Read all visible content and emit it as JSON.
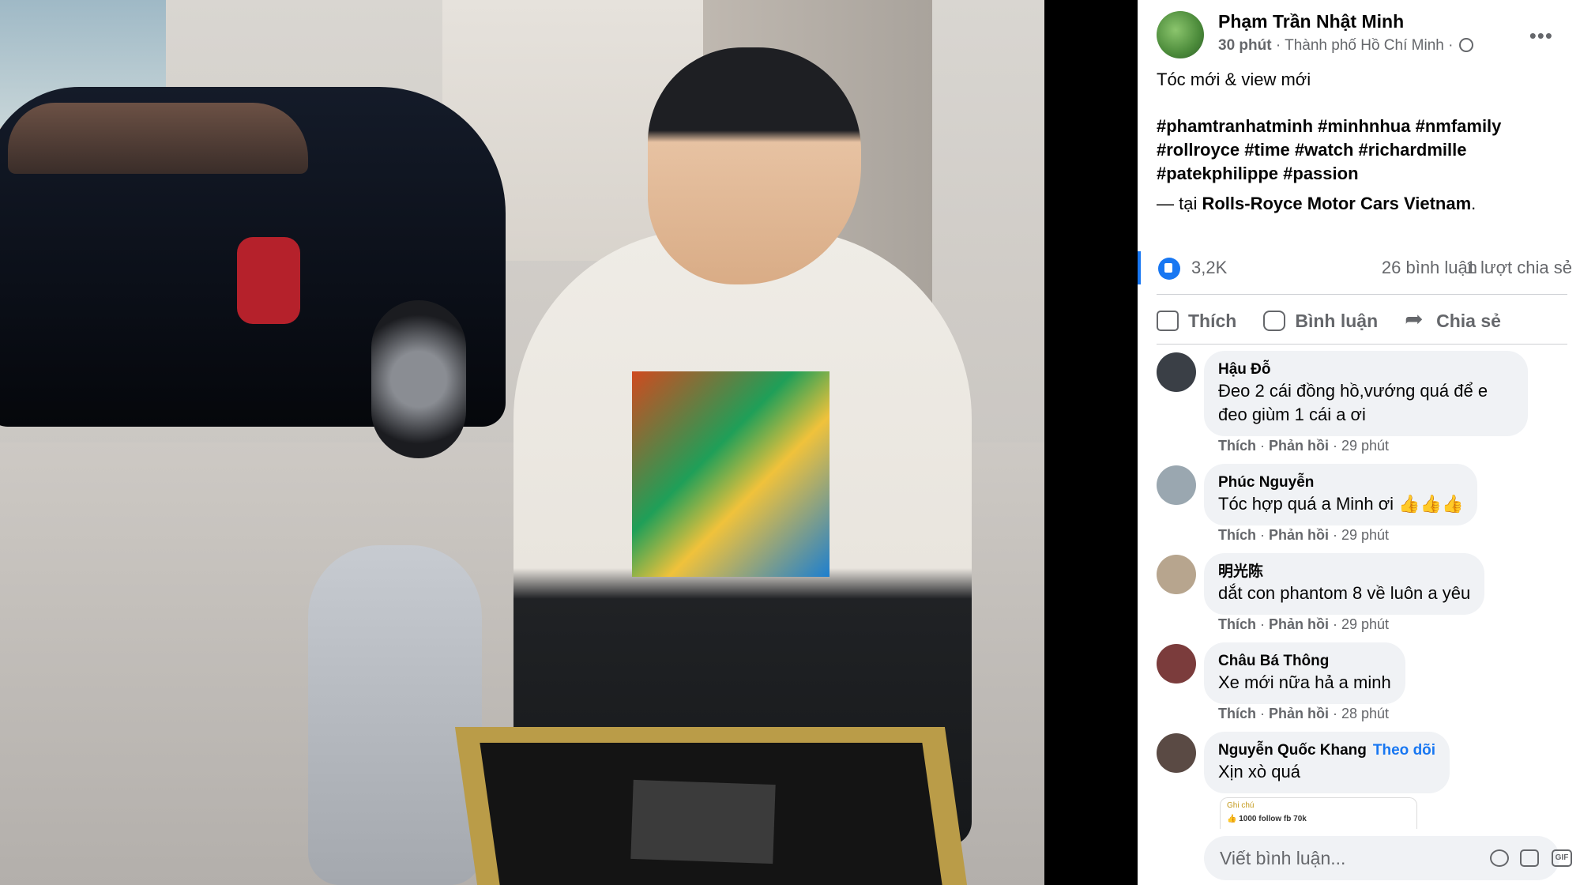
{
  "post": {
    "author": "Phạm Trần Nhật Minh",
    "time": "30 phút",
    "location": "Thành phố Hồ Chí Minh",
    "separator": "·",
    "caption": "Tóc mới & view mới",
    "hashtags": "#phamtranhatminh #minhnhua #nmfamily #rollroyce #time #watch #richardmille #patekphilippe #passion",
    "place_prefix": "— tại",
    "place_name": "Rolls-Royce Motor Cars Vietnam",
    "place_suffix": "."
  },
  "stats": {
    "likes": "3,2K",
    "comments": "26 bình luận",
    "shares": "1 lượt chia sẻ"
  },
  "actions": {
    "like": "Thích",
    "comment": "Bình luận",
    "share": "Chia sẻ"
  },
  "comments": [
    {
      "name": "Hậu Đỗ",
      "text": "Đeo 2 cái đồng hồ,vướng quá để e đeo giùm 1 cái a ơi",
      "like": "Thích",
      "reply": "Phản hồi",
      "time": "29 phút",
      "avatar_color": "#3a3f46"
    },
    {
      "name": "Phúc Nguyễn",
      "text": "Tóc hợp quá a Minh ơi 👍👍👍",
      "like": "Thích",
      "reply": "Phản hồi",
      "time": "29 phút",
      "avatar_color": "#9aa7b0"
    },
    {
      "name": "明光陈",
      "text": "dắt con phantom 8 về luôn a yêu",
      "like": "Thích",
      "reply": "Phản hồi",
      "time": "29 phút",
      "avatar_color": "#b7a58e"
    },
    {
      "name": "Châu Bá Thông",
      "text": "Xe mới nữa hả a minh",
      "like": "Thích",
      "reply": "Phản hồi",
      "time": "28 phút",
      "avatar_color": "#7b3c3c"
    },
    {
      "name": "Nguyễn Quốc Khang",
      "follow": "Theo dõi",
      "text": "Xịn xò quá",
      "avatar_color": "#5a4a44"
    }
  ],
  "attachment": {
    "note_label": "Ghi chú",
    "text": "👍 1000 follow fb 70k"
  },
  "composer": {
    "placeholder": "Viết bình luận..."
  },
  "icons": {
    "more": "more-options-icon",
    "globe": "globe-icon",
    "like_reaction": "like-reaction-icon",
    "emoji": "emoji-icon",
    "camera": "camera-icon",
    "gif": "gif-icon",
    "sticker": "sticker-icon"
  },
  "colors": {
    "accent": "#1877f2",
    "secondary_text": "#65676b",
    "bubble": "#f0f2f5"
  }
}
